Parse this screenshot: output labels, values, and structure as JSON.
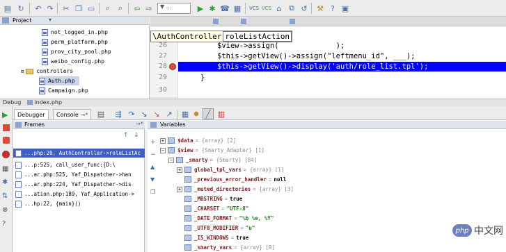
{
  "toolbar": {
    "run_config": "▼ …"
  },
  "project": {
    "header": "Project",
    "files": [
      "not_logged_in.php",
      "perm_platform.php",
      "prov_city_pool.php",
      "weibo_config.php"
    ],
    "folder": "controllers",
    "controller_files": [
      "Auth.php",
      "Campaign.php"
    ]
  },
  "editor": {
    "breadcrumb": {
      "class": "\\AuthController",
      "method": "roleListAction"
    },
    "lines": [
      {
        "num": "26",
        "code": "$view->assign(             );"
      },
      {
        "num": "27",
        "code": "$this->getView()->assign(\"leftmenu_id\", ___);"
      },
      {
        "num": "28",
        "code": "$this->getView()->display('auth/role_list.tpl');"
      },
      {
        "num": "29",
        "code": "}"
      },
      {
        "num": "30",
        "code": ""
      }
    ]
  },
  "debug": {
    "title": "Debug",
    "file": "index.php",
    "tabs": {
      "debugger": "Debugger",
      "console": "Console"
    },
    "frames_title": "Frames",
    "frames": [
      "...php:20, AuthController->roleListAc",
      "...p:525, call_user_func:{D:\\",
      "...ar.php:525, Yaf_Dispatcher->han",
      "...ar.php:224, Yaf_Dispatcher->dis",
      "...ation.php:189, Yaf_Application->",
      "...hp:22, {main}()"
    ],
    "variables_title": "Variables",
    "variables": [
      {
        "name": "$data",
        "type": "= {array} [2]",
        "value": ""
      },
      {
        "name": "$view",
        "type": "= {Smarty_Adapter} [1]",
        "value": ""
      },
      {
        "name": "_smarty",
        "type": "= {Smarty} [84]",
        "value": ""
      },
      {
        "name": "global_tpl_vars",
        "type": "= {array} [1]",
        "value": ""
      },
      {
        "name": "_previous_error_handler",
        "type": "=",
        "value": "null"
      },
      {
        "name": "_muted_directories",
        "type": "= {array} [3]",
        "value": ""
      },
      {
        "name": "_MBSTRING",
        "type": "=",
        "value": "true"
      },
      {
        "name": "_CHARSET",
        "type": "=",
        "value": "\"UTF-8\""
      },
      {
        "name": "_DATE_FORMAT",
        "type": "=",
        "value": "\"%b %e, %Y\""
      },
      {
        "name": "_UTF8_MODIFIER",
        "type": "=",
        "value": "\"u\""
      },
      {
        "name": "_IS_WINDOWS",
        "type": "=",
        "value": "true"
      },
      {
        "name": "_smarty_vars",
        "type": "= {array} [0]",
        "value": ""
      }
    ]
  },
  "watermark": {
    "logo": "php",
    "text": "中文网"
  },
  "colors": {
    "selection": "#0000ff",
    "frame_selection": "#3d5fbf",
    "breakpoint": "#d94a38"
  }
}
